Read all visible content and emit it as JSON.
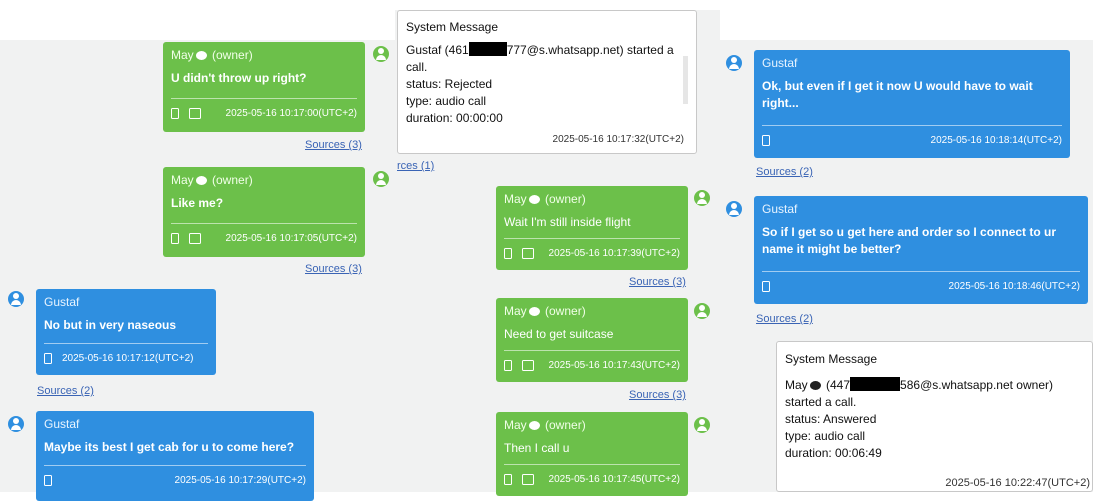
{
  "owner_label": "(owner)",
  "sources_2": "Sources (2)",
  "sources_3": "Sources (3)",
  "sources_1_partial": "rces (1)",
  "system_message_title": "System Message",
  "messages": {
    "m1": {
      "name": "May",
      "text": "U didn't throw up right?",
      "time": "2025-05-16 10:17:00(UTC+2)"
    },
    "m2": {
      "name": "May",
      "text": "Like me?",
      "time": "2025-05-16 10:17:05(UTC+2)"
    },
    "m3": {
      "name": "Gustaf",
      "text": "No but in very naseous",
      "time": "2025-05-16 10:17:12(UTC+2)"
    },
    "m4": {
      "name": "Gustaf",
      "text": "Maybe its best I get cab for u to come here?",
      "time": "2025-05-16 10:17:29(UTC+2)"
    },
    "m5": {
      "name": "May",
      "text": "Wait I'm still inside flight",
      "time": "2025-05-16 10:17:39(UTC+2)"
    },
    "m6": {
      "name": "May",
      "text": "Need to get suitcase",
      "time": "2025-05-16 10:17:43(UTC+2)"
    },
    "m7": {
      "name": "May",
      "text": "Then I call u",
      "time": "2025-05-16 10:17:45(UTC+2)"
    },
    "m8": {
      "name": "Gustaf",
      "text1": "Ok, but even if I get it now U would have to wait",
      "text2": "right...",
      "time": "2025-05-16 10:18:14(UTC+2)"
    },
    "m9": {
      "name": "Gustaf",
      "text1": "So if I get so u get here and order so I connect to ur",
      "text2": "name it might be better?",
      "time": "2025-05-16 10:18:46(UTC+2)"
    }
  },
  "system1": {
    "line1_a": "Gustaf (461",
    "line1_b": "777@s.whatsapp.net) started a",
    "line2": "call.",
    "line3": "status: Rejected",
    "line4": "type: audio call",
    "line5": "duration: 00:00:00",
    "time": "2025-05-16 10:17:32(UTC+2)"
  },
  "system2": {
    "line1_a": "May",
    "line1_b": "(447",
    "line1_c": "586@s.whatsapp.net owner)",
    "line2": "started a call.",
    "line3": "status: Answered",
    "line4": "type: audio call",
    "line5": "duration: 00:06:49",
    "time": "2025-05-16 10:22:47(UTC+2)"
  },
  "colors": {
    "owner_bubble": "#6cc04a",
    "contact_bubble": "#2f8fe0",
    "link": "#3a64b5"
  },
  "icons": [
    "user-avatar-icon",
    "phone-icon",
    "calendar-icon",
    "emoji-face-icon"
  ]
}
